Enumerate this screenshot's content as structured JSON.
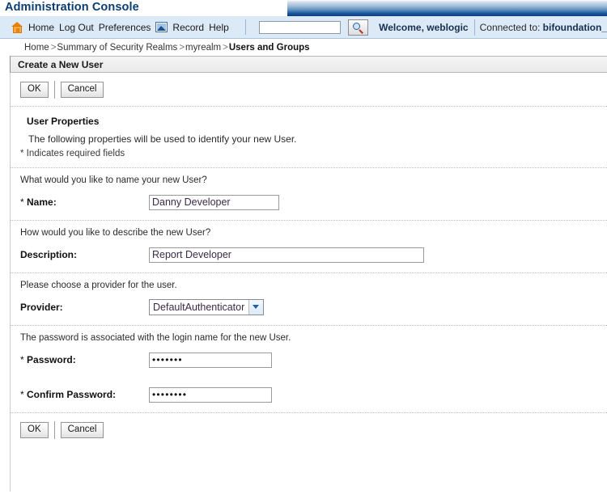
{
  "banner": {
    "title": "Administration Console"
  },
  "toolbar": {
    "home_icon": "home-icon",
    "links": [
      {
        "label": "Home"
      },
      {
        "label": "Log Out"
      },
      {
        "label": "Preferences"
      },
      {
        "label": "Record"
      },
      {
        "label": "Help"
      }
    ],
    "record_icon": "record-chart-icon",
    "search": {
      "value": "",
      "placeholder": ""
    },
    "search_icon": "magnifier-icon",
    "welcome": "Welcome, weblogic",
    "connected_prefix": "Connected to: ",
    "connected_target": "bifoundation_"
  },
  "breadcrumb": {
    "items": [
      {
        "label": "Home",
        "current": false
      },
      {
        "label": "Summary of Security Realms",
        "current": false
      },
      {
        "label": "myrealm",
        "current": false
      },
      {
        "label": "Users and Groups",
        "current": true
      }
    ],
    "separator": ">"
  },
  "page": {
    "header_title": "Create a New User"
  },
  "buttons": {
    "ok_label": "OK",
    "cancel_label": "Cancel"
  },
  "user_properties": {
    "section_title": "User Properties",
    "section_desc": "The following properties will be used to identify your new User.",
    "required_note": "* Indicates required fields"
  },
  "fields": {
    "name": {
      "question": "What would you like to name your new User?",
      "label": "Name:",
      "star": "*",
      "value": "Danny Developer"
    },
    "description": {
      "question": "How would you like to describe the new User?",
      "label": "Description:",
      "value": "Report Developer"
    },
    "provider": {
      "question": "Please choose a provider for the user.",
      "label": "Provider:",
      "selected": "DefaultAuthenticator",
      "options": [
        "DefaultAuthenticator"
      ]
    },
    "password": {
      "question": "The password is associated with the login name for the new User.",
      "label": "Password:",
      "star": "*",
      "value": "•••••••"
    },
    "confirm_password": {
      "label": "Confirm Password:",
      "star": "*",
      "value": "••••••••"
    }
  },
  "colors": {
    "banner_blue": "#0d3c78",
    "toolbar_bg": "#dce9f7",
    "title_text": "#0b3d73",
    "input_text": "#3b2a47",
    "accent_orange": "#e8820c"
  }
}
